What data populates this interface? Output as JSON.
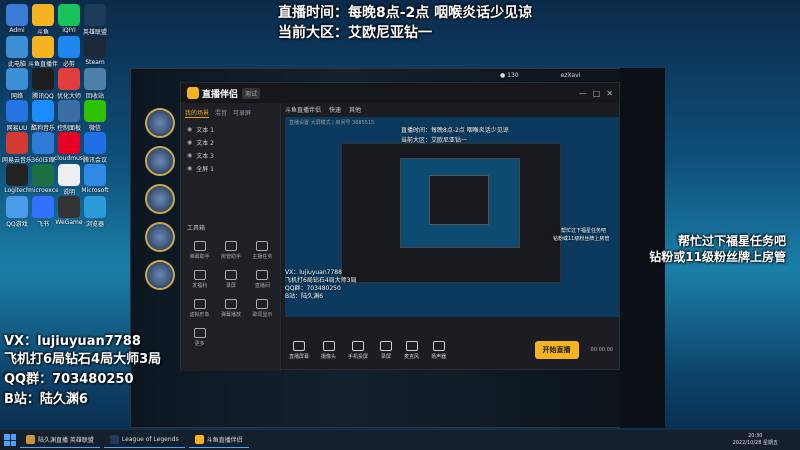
{
  "overlay": {
    "top_line1": "直播时间：每晚8点-2点   咽喉炎话少见谅",
    "top_line2": "当前大区：艾欧尼亚钻一",
    "left_lines": [
      "VX：lujiuyuan7788",
      "飞机打6局钻石4局大师3局",
      "QQ群：703480250",
      "B站：陆久渊6"
    ],
    "right_lines": [
      "帮忙过下福星任务吧",
      "钻粉或11级粉丝牌上房管"
    ]
  },
  "desktop_icons": [
    {
      "label": "Admi",
      "color": "#3a7bd5"
    },
    {
      "label": "斗鱼",
      "color": "#f6b321"
    },
    {
      "label": "iQIYI",
      "color": "#19c35c"
    },
    {
      "label": "英雄联盟",
      "color": "#1b3a5c"
    },
    {
      "label": "此电脑",
      "color": "#3c8fd4"
    },
    {
      "label": "斗鱼直播伴侣",
      "color": "#f6b321"
    },
    {
      "label": "必剪",
      "color": "#1e87f0"
    },
    {
      "label": "Steam",
      "color": "#1b2838"
    },
    {
      "label": "网络",
      "color": "#3c8fd4"
    },
    {
      "label": "腾讯QQ",
      "color": "#1e1e1e"
    },
    {
      "label": "优化大师",
      "color": "#e23d3d"
    },
    {
      "label": "回收站",
      "color": "#4e7fa8"
    },
    {
      "label": "网易UU",
      "color": "#2573e0"
    },
    {
      "label": "酷狗音乐",
      "color": "#1a8cff"
    },
    {
      "label": "控制面板",
      "color": "#3a6ea5"
    },
    {
      "label": "微信",
      "color": "#2dc100"
    },
    {
      "label": "网易云音乐",
      "color": "#d33a31"
    },
    {
      "label": "360压缩",
      "color": "#2e7bd6"
    },
    {
      "label": "cloudmusic",
      "color": "#e60026"
    },
    {
      "label": "腾讯会议",
      "color": "#1f6fe5"
    },
    {
      "label": "Logitech",
      "color": "#222"
    },
    {
      "label": "microexcel",
      "color": "#1d7044"
    },
    {
      "label": "说明",
      "color": "#eee"
    },
    {
      "label": "Microsoft",
      "color": "#2e8ae6"
    },
    {
      "label": "QQ游戏",
      "color": "#4c9be8"
    },
    {
      "label": "飞书",
      "color": "#3370ff"
    },
    {
      "label": "WeGame",
      "color": "#333"
    },
    {
      "label": "浏览器",
      "color": "#2a9ad8"
    }
  ],
  "app": {
    "name": "直播伴侣",
    "version": "测试",
    "window_controls": [
      "—",
      "□",
      "✕"
    ],
    "tabs": [
      "我的场景",
      "混音",
      "可录屏"
    ],
    "scenes": [
      "文本 1",
      "文本 2",
      "文本 3",
      "全屏 1"
    ],
    "tools_title": "工具箱",
    "tools": [
      "弹幕助手",
      "房管助手",
      "主播任务",
      "发福利",
      "录屏",
      "直播间",
      "虚拟形象",
      "弹幕播放",
      "歌词显示",
      "更多"
    ],
    "preview_header": [
      "斗鱼直播伴侣",
      "快速",
      "其他"
    ],
    "preview_sub": "直播设置  大屏模式 | 房间号 3685515",
    "bottom_actions": [
      "直播屏幕",
      "摄像头",
      "手机投屏",
      "录屏",
      "麦克风",
      "扬声器"
    ],
    "start_button": "开始直播",
    "timer": "00:00:00"
  },
  "mini_overlay": {
    "line1": "直播时间：每晚8点-2点   咽喉炎话少见谅",
    "line2": "当前大区：艾欧尼亚钻一",
    "left": [
      "VX：lujiuyuan7788",
      "飞机打6局钻石4局大师3局",
      "QQ群：703480250",
      "B站：陆久渊6"
    ],
    "right": [
      "帮忙过下福星任务吧",
      "钻粉或11级粉丝牌上房管"
    ]
  },
  "lol": {
    "top_right": "130",
    "username": "ezXavi"
  },
  "taskbar": {
    "apps": [
      {
        "label": "陆久渊直播 英雄联盟",
        "color": "#c9963b"
      },
      {
        "label": "League of Legends",
        "color": "#1b3a5c"
      },
      {
        "label": "斗鱼直播伴侣",
        "color": "#f6b321"
      }
    ],
    "time": "20:30",
    "date": "2022/10/28 星期五"
  }
}
